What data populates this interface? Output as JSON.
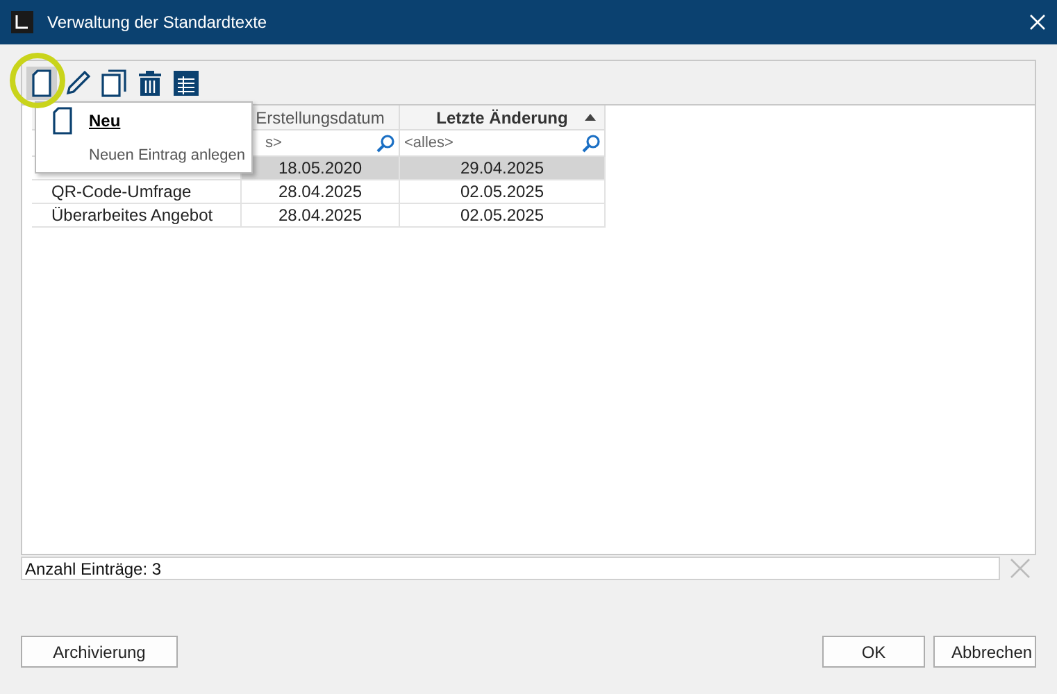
{
  "window": {
    "title": "Verwaltung der Standardtexte"
  },
  "toolbar": [
    {
      "kind": "new",
      "pressed": true
    },
    {
      "kind": "edit",
      "pressed": false
    },
    {
      "kind": "copy",
      "pressed": false
    },
    {
      "kind": "delete",
      "pressed": false
    },
    {
      "kind": "table",
      "pressed": false
    }
  ],
  "popup": {
    "title": "Neu",
    "description": "Neuen Eintrag anlegen"
  },
  "table": {
    "columns": [
      {},
      {
        "label": "Erstellungsdatum",
        "filter": "s>",
        "sorted": false
      },
      {
        "label": "Letzte Änderung",
        "filter": "<alles>",
        "sorted": true
      }
    ],
    "rows": [
      {
        "cells": [
          null,
          "18.05.2020",
          "29.04.2025"
        ],
        "selected": true
      },
      {
        "cells": [
          "QR-Code-Umfrage",
          "28.04.2025",
          "02.05.2025"
        ],
        "selected": false
      },
      {
        "cells": [
          "Überarbeites Angebot",
          "28.04.2025",
          "02.05.2025"
        ],
        "selected": false
      }
    ]
  },
  "status": "Anzahl Einträge: 3",
  "buttons_left": [
    "Archivierung"
  ],
  "buttons_right": [
    "OK",
    "Abbrechen"
  ]
}
